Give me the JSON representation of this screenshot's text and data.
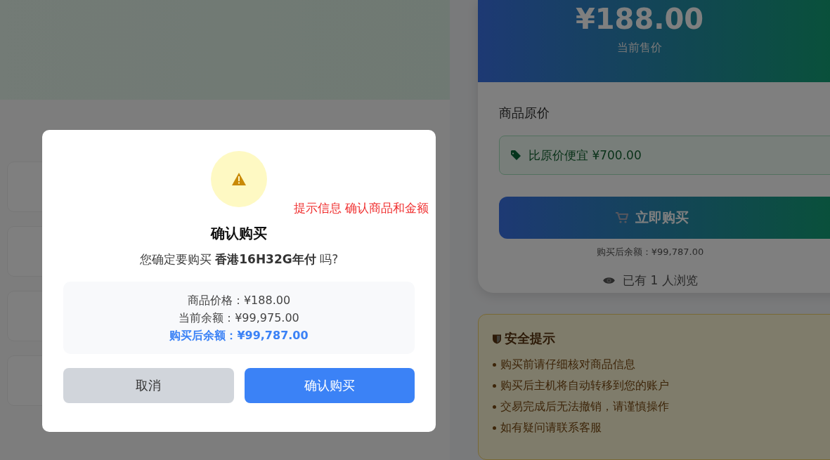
{
  "left_cards": [
    {
      "kind": "card"
    },
    {
      "kind": "card"
    },
    {
      "kind": "card"
    },
    {
      "kind": "card"
    }
  ],
  "product_card": {
    "price": "¥188.00",
    "price_label": "当前售价",
    "original_price_label": "商品原价",
    "discount": "比原价便宜 ¥700.00",
    "buy_button": "立即购买",
    "balance_after": "购买后余额：¥99,787.00",
    "views": "已有 1 人浏览"
  },
  "safety_tips": {
    "title": "安全提示",
    "items": [
      "购买前请仔细核对商品信息",
      "购买后主机将自动转移到您的账户",
      "交易完成后无法撤销，请谨慎操作",
      "如有疑问请联系客服"
    ]
  },
  "dialog": {
    "title": "确认购买",
    "question": "您确定要购买 **香港16H32G年付** 吗?",
    "lines": [
      {
        "text": "商品价格：¥188.00",
        "highlight": false
      },
      {
        "text": "当前余额：¥99,975.00",
        "highlight": false
      },
      {
        "text": "购买后余额：¥99,787.00",
        "highlight": true
      }
    ],
    "buttons": [
      {
        "label": "取消",
        "kind": "secondary"
      },
      {
        "label": "确认购买",
        "kind": "primary"
      }
    ]
  },
  "annotation": "提示信息 确认商品和金额"
}
